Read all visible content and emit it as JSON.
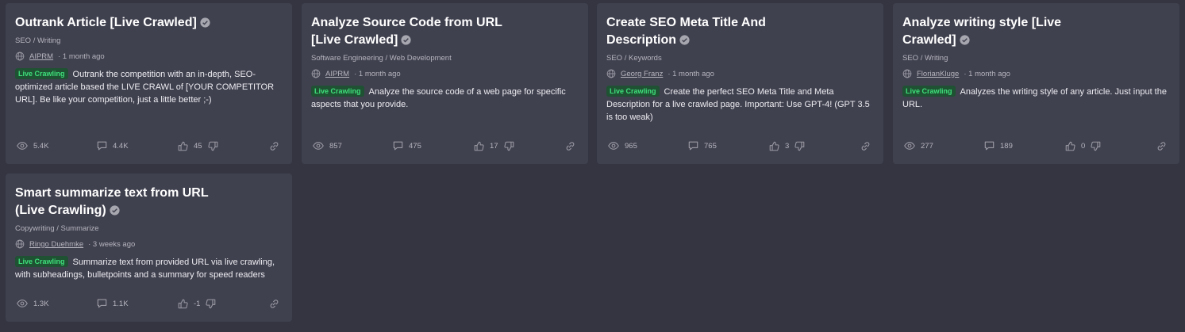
{
  "cards": [
    {
      "title": "Outrank Article [Live Crawled]",
      "category": "SEO / Writing",
      "author": "AIPRM",
      "time": "· 1 month ago",
      "badge": "Live Crawling",
      "description": "Outrank the competition with an in-depth, SEO-optimized article based the LIVE CRAWL of [YOUR COMPETITOR URL]. Be like your competition, just a little better ;-)",
      "views": "5.4K",
      "comments": "4.4K",
      "likes": "45"
    },
    {
      "title": "Analyze Source Code from URL [Live Crawled]",
      "category": "Software Engineering / Web Development",
      "author": "AIPRM",
      "time": "· 1 month ago",
      "badge": "Live Crawling",
      "description": "Analyze the source code of a web page for specific aspects that you provide.",
      "views": "857",
      "comments": "475",
      "likes": "17"
    },
    {
      "title": "Create SEO Meta Title And Description",
      "category": "SEO / Keywords",
      "author": "Georg Franz",
      "time": "· 1 month ago",
      "badge": "Live Crawling",
      "description": "Create the perfect SEO Meta Title and Meta Description for a live crawled page. Important: Use GPT-4! (GPT 3.5 is too weak)",
      "views": "965",
      "comments": "765",
      "likes": "3"
    },
    {
      "title": "Analyze writing style [Live Crawled]",
      "category": "SEO / Writing",
      "author": "FlorianKluge",
      "time": "· 1 month ago",
      "badge": "Live Crawling",
      "description": "Analyzes the writing style of any article. Just input the URL.",
      "views": "277",
      "comments": "189",
      "likes": "0"
    },
    {
      "title": "Smart summarize text from URL (Live Crawling)",
      "category": "Copywriting / Summarize",
      "author": "Ringo Duehmke",
      "time": "· 3 weeks ago",
      "badge": "Live Crawling",
      "description": "Summarize text from provided URL via live crawling, with subheadings, bulletpoints and a summary for speed readers",
      "views": "1.3K",
      "comments": "1.1K",
      "likes": "-1"
    }
  ],
  "colors": {
    "page_bg": "#343541",
    "card_bg": "#40414f",
    "badge_text": "#3ee07a",
    "badge_bg": "#1f5133"
  },
  "icons": [
    "verified-check-icon",
    "globe-icon",
    "eye-icon",
    "comment-icon",
    "thumbs-up-icon",
    "thumbs-down-icon",
    "link-icon"
  ]
}
